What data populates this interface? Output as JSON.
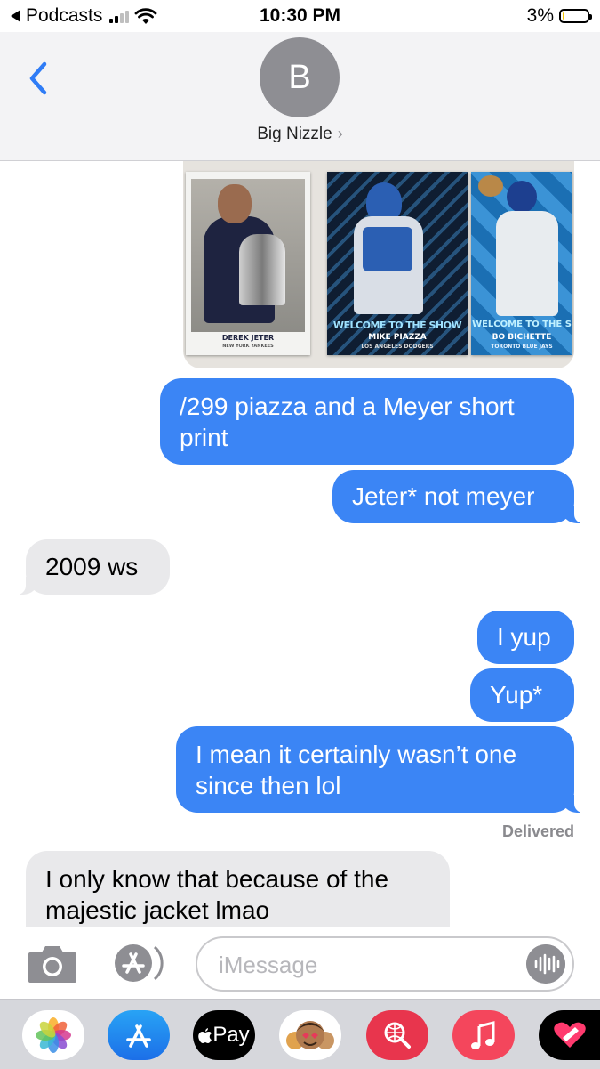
{
  "status_bar": {
    "back_app": "Podcasts",
    "time": "10:30 PM",
    "battery_percent": "3%",
    "battery_level": 0.03,
    "signal_bars_active": 2,
    "battery_color": "#f4c400"
  },
  "header": {
    "avatar_initial": "B",
    "contact_name": "Big Nizzle",
    "contact_chevron": "›"
  },
  "photo": {
    "cards": [
      {
        "player": "DEREK JETER",
        "team": "NEW YORK YANKEES"
      },
      {
        "banner": "WELCOME TO THE SHOW",
        "player": "MIKE PIAZZA",
        "team": "LOS ANGELES DODGERS"
      },
      {
        "banner": "WELCOME TO THE S",
        "player": "BO BICHETTE",
        "team": "TORONTO BLUE JAYS"
      }
    ]
  },
  "messages": [
    {
      "direction": "outgoing",
      "text": "/299 piazza and a Meyer short print"
    },
    {
      "direction": "outgoing",
      "text": "Jeter* not meyer"
    },
    {
      "direction": "incoming",
      "text": "2009 ws"
    },
    {
      "direction": "outgoing",
      "text": "I yup"
    },
    {
      "direction": "outgoing",
      "text": "Yup*"
    },
    {
      "direction": "outgoing",
      "text": "I mean it certainly wasn’t one since then lol"
    },
    {
      "direction": "incoming",
      "text": "I only know that because of the majestic jacket lmao"
    }
  ],
  "delivered_label": "Delivered",
  "input": {
    "placeholder": "iMessage"
  },
  "drawer": {
    "icons": [
      "photos-icon",
      "app-store-icon",
      "apple-pay-icon",
      "memoji-icon",
      "web-search-icon",
      "music-icon",
      "digital-touch-icon"
    ],
    "apple_pay_label": "Pay"
  },
  "colors": {
    "outgoing_bubble": "#3b85f5",
    "incoming_bubble": "#e9e9eb",
    "accent": "#2f7cf6"
  }
}
